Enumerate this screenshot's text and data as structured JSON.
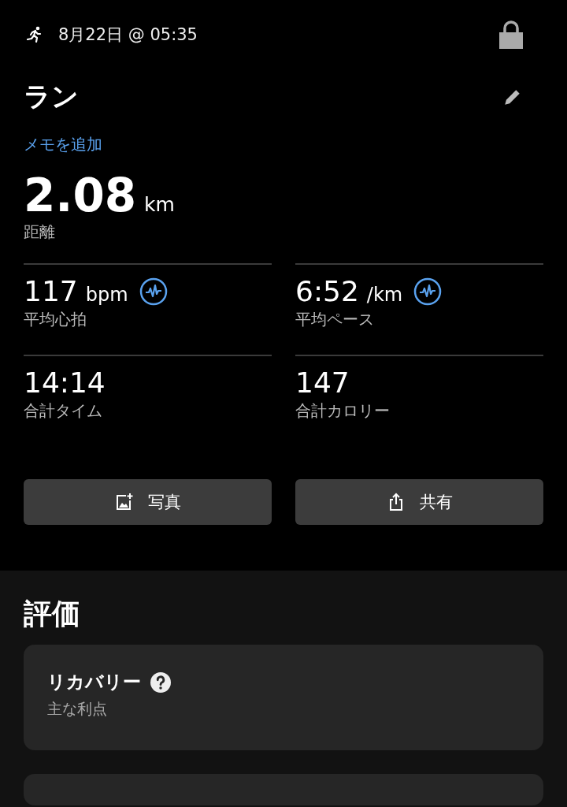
{
  "header": {
    "date": "8月22日 @ 05:35"
  },
  "activity": {
    "title": "ラン",
    "add_note": "メモを追加"
  },
  "distance": {
    "value": "2.08",
    "unit": "km",
    "label": "距離"
  },
  "metrics": [
    {
      "value": "117",
      "unit": "bpm",
      "label": "平均心拍",
      "analysis": true
    },
    {
      "value": "6:52",
      "unit": "/km",
      "label": "平均ペース",
      "analysis": true
    },
    {
      "value": "14:14",
      "label": "合計タイム",
      "analysis": false
    },
    {
      "value": "147",
      "label": "合計カロリー",
      "analysis": false
    }
  ],
  "actions": [
    {
      "kind": "photo",
      "label": "写真"
    },
    {
      "kind": "share",
      "label": "共有"
    }
  ],
  "evaluation": {
    "title": "評価",
    "cards": [
      {
        "title": "リカバリー",
        "subtitle": "主な利点",
        "help": true
      }
    ]
  }
}
